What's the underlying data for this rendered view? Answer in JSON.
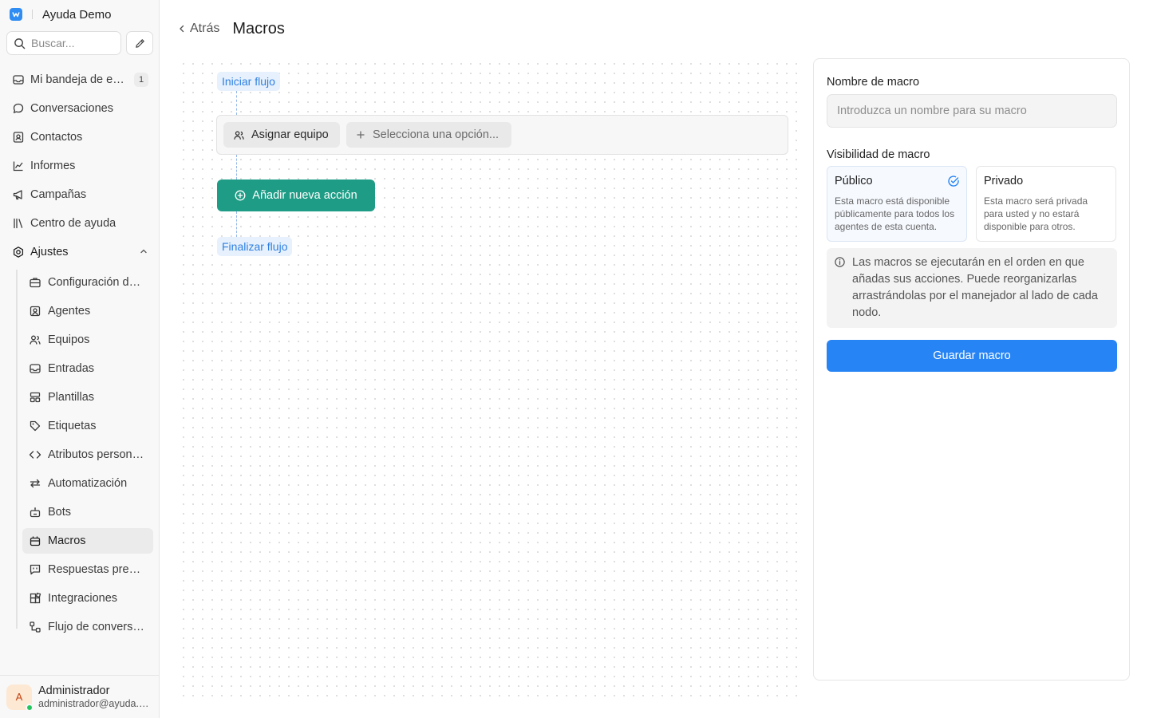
{
  "app": {
    "name": "Ayuda Demo"
  },
  "search": {
    "placeholder": "Buscar..."
  },
  "sidebar": {
    "items": [
      {
        "label": "Mi bandeja de entrada",
        "icon": "inbox-icon",
        "badge": "1"
      },
      {
        "label": "Conversaciones",
        "icon": "chat-bubble-icon"
      },
      {
        "label": "Contactos",
        "icon": "contact-card-icon"
      },
      {
        "label": "Informes",
        "icon": "line-chart-icon"
      },
      {
        "label": "Campañas",
        "icon": "megaphone-icon"
      },
      {
        "label": "Centro de ayuda",
        "icon": "library-icon"
      },
      {
        "label": "Ajustes",
        "icon": "settings-icon",
        "expanded": true
      }
    ],
    "settings_items": [
      {
        "label": "Configuración de la cuenta",
        "icon": "briefcase-icon"
      },
      {
        "label": "Agentes",
        "icon": "agent-icon"
      },
      {
        "label": "Equipos",
        "icon": "team-icon"
      },
      {
        "label": "Entradas",
        "icon": "inbox-icon"
      },
      {
        "label": "Plantillas",
        "icon": "template-icon"
      },
      {
        "label": "Etiquetas",
        "icon": "tag-icon"
      },
      {
        "label": "Atributos personalizados",
        "icon": "code-icon"
      },
      {
        "label": "Automatización",
        "icon": "automation-icon"
      },
      {
        "label": "Bots",
        "icon": "bot-icon"
      },
      {
        "label": "Macros",
        "icon": "macro-icon",
        "active": true
      },
      {
        "label": "Respuestas predefinidas",
        "icon": "canned-response-icon"
      },
      {
        "label": "Integraciones",
        "icon": "integrations-icon"
      },
      {
        "label": "Flujo de conversación",
        "icon": "flow-icon"
      }
    ]
  },
  "user": {
    "initial": "A",
    "name": "Administrador",
    "email": "administrador@ayuda.demo",
    "status_color": "#22c55e"
  },
  "header": {
    "back_label": "Atrás",
    "title": "Macros"
  },
  "flow": {
    "start_label": "Iniciar flujo",
    "action": {
      "type_label": "Asignar equipo",
      "select_placeholder": "Selecciona una opción..."
    },
    "add_action_label": "Añadir nueva acción",
    "end_label": "Finalizar flujo"
  },
  "form": {
    "name_label": "Nombre de macro",
    "name_placeholder": "Introduzca un nombre para su macro",
    "name_value": "",
    "visibility_label": "Visibilidad de macro",
    "visibility_options": [
      {
        "title": "Público",
        "description": "Esta macro está disponible públicamente para todos los agentes de esta cuenta.",
        "selected": true
      },
      {
        "title": "Privado",
        "description": "Esta macro será privada para usted y no estará disponible para otros.",
        "selected": false
      }
    ],
    "info_text": "Las macros se ejecutarán en el orden en que añadas sus acciones. Puede reorganizarlas arrastrándolas por el manejador al lado de cada nodo.",
    "save_label": "Guardar macro"
  },
  "colors": {
    "accent": "#2684f4",
    "add_action": "#1e9c85",
    "flow_pill_bg": "#e6f1fd",
    "flow_pill_text": "#2f7fe0"
  }
}
